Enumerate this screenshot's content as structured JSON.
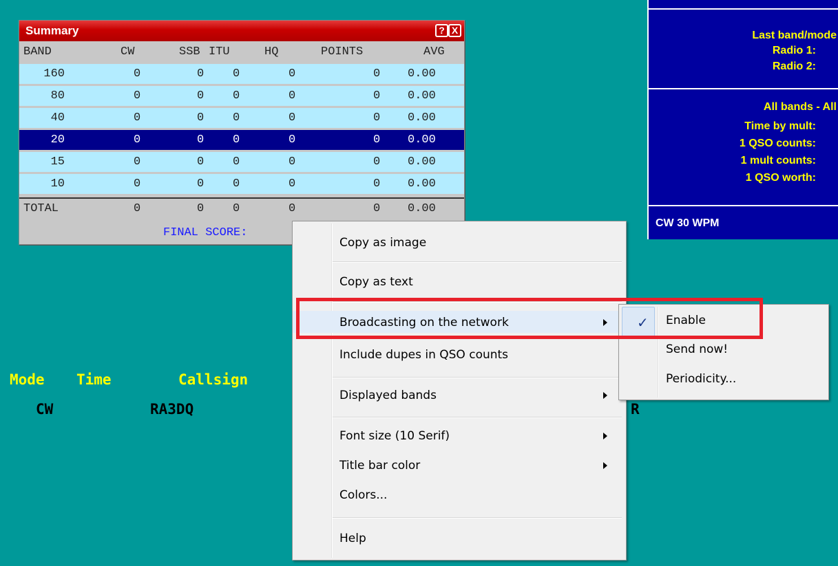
{
  "summary": {
    "title": "Summary",
    "help_button": "?",
    "close_button": "X",
    "headers": [
      "BAND",
      "CW",
      "SSB",
      "ITU",
      "HQ",
      "POINTS",
      "AVG"
    ],
    "rows": [
      [
        "160",
        "0",
        "0",
        "0",
        "0",
        "0",
        "0.00"
      ],
      [
        "80",
        "0",
        "0",
        "0",
        "0",
        "0",
        "0.00"
      ],
      [
        "40",
        "0",
        "0",
        "0",
        "0",
        "0",
        "0.00"
      ],
      [
        "20",
        "0",
        "0",
        "0",
        "0",
        "0",
        "0.00"
      ],
      [
        "15",
        "0",
        "0",
        "0",
        "0",
        "0",
        "0.00"
      ],
      [
        "10",
        "0",
        "0",
        "0",
        "0",
        "0",
        "0.00"
      ]
    ],
    "selected_row": 3,
    "total": [
      "TOTAL",
      "0",
      "0",
      "0",
      "0",
      "0",
      "0.00"
    ],
    "final_score_label": "FINAL SCORE:"
  },
  "right_panel": {
    "last_band_mode": "Last band/mode",
    "radio1": "Radio 1:",
    "radio2": "Radio 2:",
    "all_bands": "All bands - All",
    "time_by_mult": "Time by mult:",
    "qso_counts": "1 QSO counts:",
    "mult_counts": "1 mult counts:",
    "qso_worth": "1 QSO worth:",
    "status": "CW  30 WPM"
  },
  "log": {
    "headers": [
      "Mode",
      "Time",
      "Callsign"
    ],
    "entry": {
      "mode": "CW",
      "callsign": "RA3DQ",
      "trailing": "R"
    }
  },
  "context_menu": {
    "items": [
      {
        "label": "Copy as image"
      },
      {
        "label": "Copy as text"
      },
      {
        "label": "Broadcasting on the network",
        "submenu": true
      },
      {
        "label": "Include dupes in QSO counts"
      },
      {
        "label": "Displayed bands",
        "submenu": true
      },
      {
        "label": "Font size (10 Serif)",
        "submenu": true
      },
      {
        "label": "Title bar color",
        "submenu": true
      },
      {
        "label": "Colors..."
      },
      {
        "label": "Help"
      }
    ],
    "highlighted": "Broadcasting on the network"
  },
  "submenu": {
    "items": [
      {
        "label": "Enable",
        "checked": true
      },
      {
        "label": "Send now!"
      },
      {
        "label": "Periodicity..."
      }
    ],
    "check_glyph": "✓"
  },
  "colors": {
    "background": "#009999",
    "title_bar": "#c80000",
    "row_bg": "#b3ecff",
    "selected_row_bg": "#00008b",
    "panel_bg": "#0000a0",
    "panel_text": "#ffff00",
    "highlight_box": "#e8212b"
  }
}
